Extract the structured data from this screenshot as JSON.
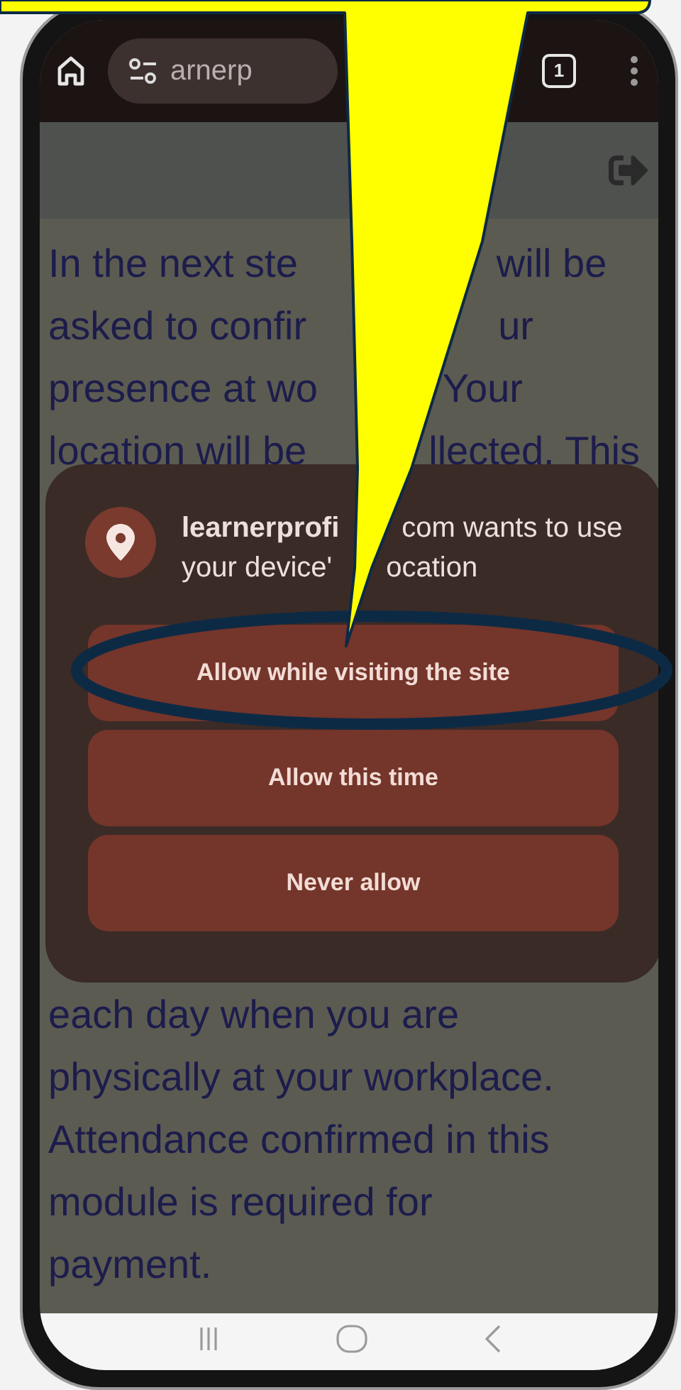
{
  "browser": {
    "address": "arnerp",
    "tab_count": "1"
  },
  "page": {
    "lines_top": [
      {
        "left": "In the next ste",
        "right": "will be"
      },
      {
        "left": "asked to confir",
        "right": "ur"
      },
      {
        "left": "presence at wo",
        "right": "Your"
      },
      {
        "left": "location will be",
        "right": "llected. This"
      }
    ],
    "lines_bottom": [
      "each day when you are",
      "physically at your workplace.",
      "Attendance confirmed in this",
      "module is required for",
      "payment."
    ]
  },
  "dialog": {
    "site": "learnerprofi",
    "message_rest": "com wants to use",
    "line2_left": "your device'",
    "line2_right": "ocation",
    "buttons": [
      {
        "label": "Allow while visiting the site",
        "highlighted": true
      },
      {
        "label": "Allow this time",
        "highlighted": false
      },
      {
        "label": "Never allow",
        "highlighted": false
      }
    ]
  }
}
